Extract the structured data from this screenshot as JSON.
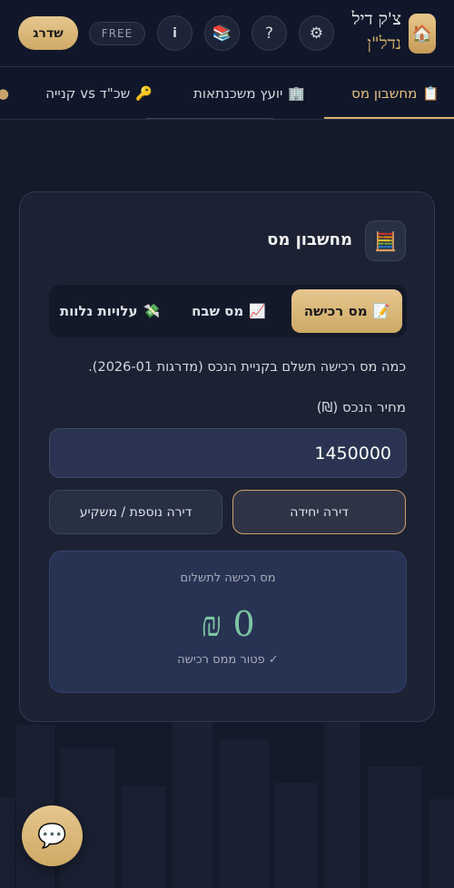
{
  "header": {
    "brand_line1": "צ'ק דיל",
    "brand_line2": "נדל\"ן",
    "logo_icon": "🏠",
    "settings_icon": "⚙",
    "help_icon": "?",
    "library_icon": "📚",
    "info_icon": "i",
    "free_badge": "FREE",
    "upgrade_label": "שדרג"
  },
  "nav": {
    "tabs": [
      {
        "icon": "📋",
        "label": "מחשבון מס"
      },
      {
        "icon": "🏢",
        "label": "יועץ משכנתאות"
      },
      {
        "icon": "🔑",
        "label": "שכ\"ד vs קנייה"
      }
    ]
  },
  "card": {
    "icon": "🧮",
    "title": "מחשבון מס",
    "segments": [
      {
        "icon": "📝",
        "label": "מס רכישה"
      },
      {
        "icon": "📈",
        "label": "מס שבח"
      },
      {
        "icon": "💸",
        "label": "עלויות נלוות"
      }
    ],
    "description": "כמה מס רכישה תשלם בקניית הנכס (מדרגות 2026-01).",
    "price_label": "מחיר הנכס (₪)",
    "price_value": "1450000",
    "options": [
      {
        "label": "דירה יחידה"
      },
      {
        "label": "דירה נוספת / משקיע"
      }
    ],
    "result": {
      "label": "מס רכישה לתשלום",
      "value": "0 ₪",
      "note": "✓ פטור ממס רכישה"
    }
  },
  "chat": {
    "icon": "💬"
  },
  "colors": {
    "accent_gold": "#d9b36b",
    "background": "#141a2a",
    "result_green": "#7cc6a3"
  }
}
